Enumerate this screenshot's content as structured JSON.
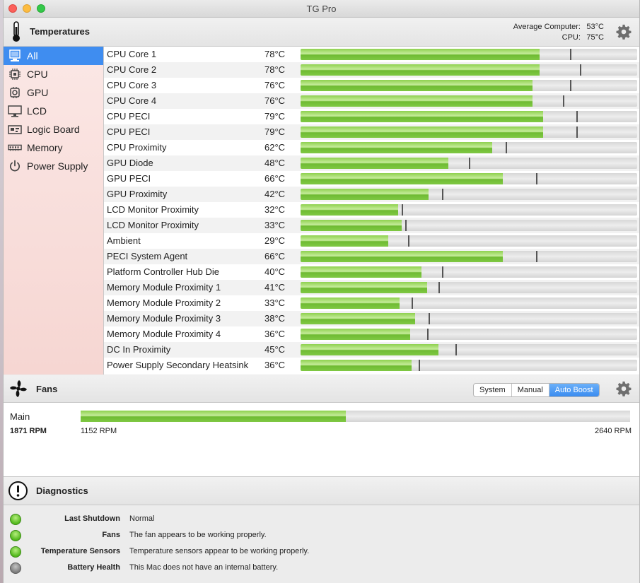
{
  "window": {
    "title": "TG Pro"
  },
  "temperatures": {
    "header": "Temperatures",
    "summary": [
      {
        "label": "Average Computer:",
        "value": "53°C"
      },
      {
        "label": "CPU:",
        "value": "75°C"
      }
    ],
    "sidebar": [
      {
        "label": "All",
        "icon": "computer-icon",
        "selected": true
      },
      {
        "label": "CPU",
        "icon": "cpu-icon"
      },
      {
        "label": "GPU",
        "icon": "gpu-icon"
      },
      {
        "label": "LCD",
        "icon": "display-icon"
      },
      {
        "label": "Logic Board",
        "icon": "logic-board-icon"
      },
      {
        "label": "Memory",
        "icon": "memory-icon"
      },
      {
        "label": "Power Supply",
        "icon": "power-icon"
      }
    ],
    "sensors": [
      {
        "name": "CPU Core 1",
        "value": "78°C",
        "level": 0.71,
        "max": 0.8
      },
      {
        "name": "CPU Core 2",
        "value": "78°C",
        "level": 0.71,
        "max": 0.83
      },
      {
        "name": "CPU Core 3",
        "value": "76°C",
        "level": 0.69,
        "max": 0.8
      },
      {
        "name": "CPU Core 4",
        "value": "76°C",
        "level": 0.69,
        "max": 0.78
      },
      {
        "name": "CPU PECI",
        "value": "79°C",
        "level": 0.72,
        "max": 0.82
      },
      {
        "name": "CPU PECI",
        "value": "79°C",
        "level": 0.72,
        "max": 0.82
      },
      {
        "name": "CPU Proximity",
        "value": "62°C",
        "level": 0.57,
        "max": 0.61
      },
      {
        "name": "GPU Diode",
        "value": "48°C",
        "level": 0.44,
        "max": 0.5
      },
      {
        "name": "GPU PECI",
        "value": "66°C",
        "level": 0.6,
        "max": 0.7
      },
      {
        "name": "GPU Proximity",
        "value": "42°C",
        "level": 0.38,
        "max": 0.42
      },
      {
        "name": "LCD Monitor Proximity",
        "value": "32°C",
        "level": 0.29,
        "max": 0.3
      },
      {
        "name": "LCD Monitor Proximity",
        "value": "33°C",
        "level": 0.3,
        "max": 0.31
      },
      {
        "name": "Ambient",
        "value": "29°C",
        "level": 0.26,
        "max": 0.32
      },
      {
        "name": "PECI System Agent",
        "value": "66°C",
        "level": 0.6,
        "max": 0.7
      },
      {
        "name": "Platform Controller Hub Die",
        "value": "40°C",
        "level": 0.36,
        "max": 0.42
      },
      {
        "name": "Memory Module Proximity 1",
        "value": "41°C",
        "level": 0.375,
        "max": 0.41
      },
      {
        "name": "Memory Module Proximity 2",
        "value": "33°C",
        "level": 0.295,
        "max": 0.33
      },
      {
        "name": "Memory Module Proximity 3",
        "value": "38°C",
        "level": 0.34,
        "max": 0.38
      },
      {
        "name": "Memory Module Proximity 4",
        "value": "36°C",
        "level": 0.325,
        "max": 0.375
      },
      {
        "name": "DC In Proximity",
        "value": "45°C",
        "level": 0.41,
        "max": 0.46
      },
      {
        "name": "Power Supply Secondary Heatsink",
        "value": "36°C",
        "level": 0.33,
        "max": 0.35
      }
    ]
  },
  "fans": {
    "header": "Fans",
    "modes": [
      {
        "label": "System",
        "active": false
      },
      {
        "label": "Manual",
        "active": false
      },
      {
        "label": "Auto Boost",
        "active": true
      }
    ],
    "items": [
      {
        "name": "Main",
        "rpm": "1871 RPM",
        "min": "1152 RPM",
        "max": "2640 RPM",
        "level": 0.483
      }
    ]
  },
  "diagnostics": {
    "header": "Diagnostics",
    "items": [
      {
        "label": "Last Shutdown",
        "value": "Normal",
        "status": "green"
      },
      {
        "label": "Fans",
        "value": "The fan appears to be working properly.",
        "status": "green"
      },
      {
        "label": "Temperature Sensors",
        "value": "Temperature sensors appear to be working properly.",
        "status": "green"
      },
      {
        "label": "Battery Health",
        "value": "This Mac does not have an internal battery.",
        "status": "gray"
      }
    ]
  },
  "colors": {
    "accent": "#3f8df0",
    "bar_green": "#7fc843",
    "status_green": "#52b81c",
    "status_gray": "#7b7b7b"
  }
}
